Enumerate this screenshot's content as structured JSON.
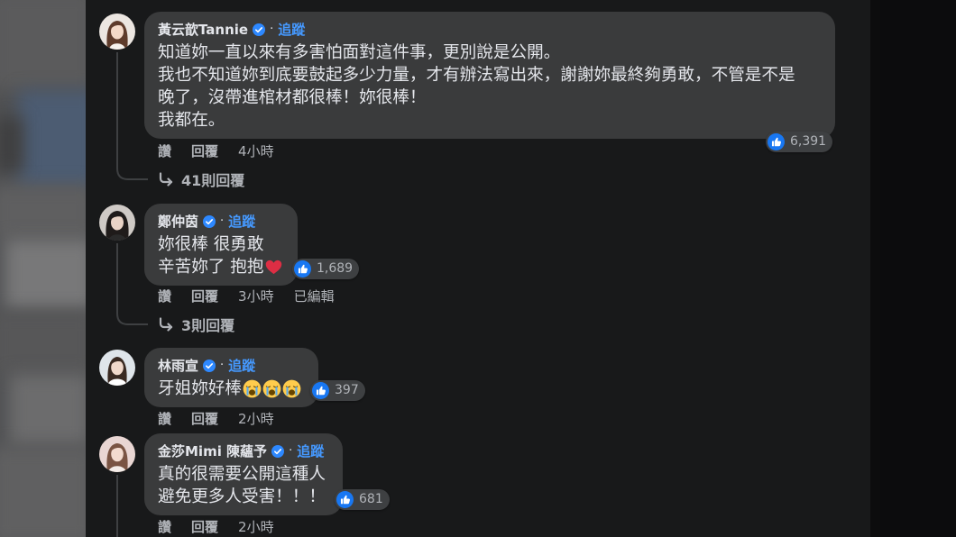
{
  "colors": {
    "page_background": "#18191a",
    "bubble_background": "#3a3b3c",
    "text_primary": "#e4e6eb",
    "text_secondary": "#b0b3b8",
    "follow_link": "#4599ff",
    "like_blue": "#1877f2",
    "verified_blue": "#2d88ff",
    "heart_red": "#dd2e44"
  },
  "comments": [
    {
      "author": "黃云歆Tannie",
      "verified_icon": "verified-badge-icon",
      "separator": "·",
      "follow_label": "追蹤",
      "body": [
        {
          "text": "知道妳一直以來有多害怕面對這件事，更別說是公開。"
        },
        {
          "text": "我也不知道妳到底要鼓起多少力量，才有辦法寫出來，謝謝妳最終夠勇敢，不管是不是"
        },
        {
          "text": "晚了，沒帶進棺材都很棒！妳很棒！"
        },
        {
          "text": "我都在。"
        }
      ],
      "reaction": {
        "icon": "like-icon",
        "count": "6,391"
      },
      "actions": {
        "like": "讚",
        "reply": "回覆",
        "time": "4小時"
      },
      "replies": {
        "icon": "reply-arrow-icon",
        "label": "41則回覆"
      }
    },
    {
      "author": "鄭仲茵",
      "verified_icon": "verified-badge-icon",
      "separator": "·",
      "follow_label": "追蹤",
      "body": [
        {
          "text": "妳很棒 很勇敢"
        },
        {
          "text": "辛苦妳了 抱抱",
          "emoji": [
            "red-heart"
          ]
        }
      ],
      "reaction": {
        "icon": "like-icon",
        "count": "1,689"
      },
      "actions": {
        "like": "讚",
        "reply": "回覆",
        "time": "3小時",
        "edited": "已編輯"
      },
      "replies": {
        "icon": "reply-arrow-icon",
        "label": "3則回覆"
      }
    },
    {
      "author": "林雨宣",
      "verified_icon": "verified-badge-icon",
      "separator": "·",
      "follow_label": "追蹤",
      "body": [
        {
          "text": "牙姐妳好棒",
          "emoji": [
            "loudly-crying-face",
            "loudly-crying-face",
            "loudly-crying-face"
          ]
        }
      ],
      "reaction": {
        "icon": "like-icon",
        "count": "397"
      },
      "actions": {
        "like": "讚",
        "reply": "回覆",
        "time": "2小時"
      }
    },
    {
      "author": "金莎Mimi 陳蘊予",
      "verified_icon": "verified-badge-icon",
      "separator": "·",
      "follow_label": "追蹤",
      "body": [
        {
          "text": "真的很需要公開這種人"
        },
        {
          "text": "避免更多人受害！！！"
        }
      ],
      "reaction": {
        "icon": "like-icon",
        "count": "681"
      },
      "actions": {
        "like": "讚",
        "reply": "回覆",
        "time": "2小時"
      }
    }
  ]
}
